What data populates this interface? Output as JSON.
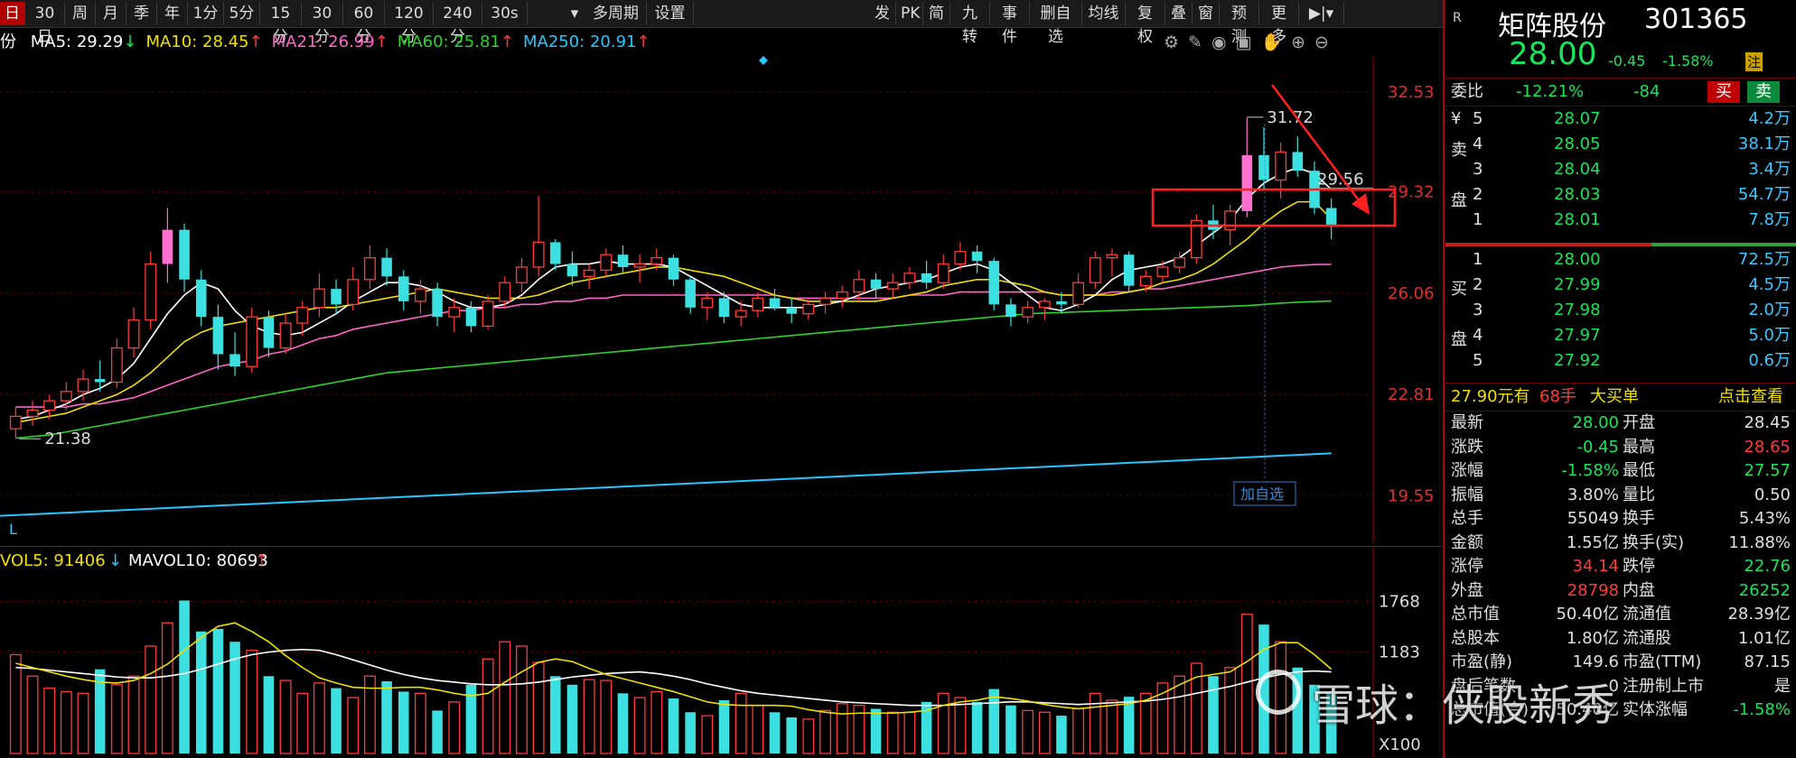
{
  "toolbar": {
    "periods": [
      "日",
      "30日",
      "周",
      "月",
      "季",
      "年",
      "1分",
      "5分",
      "15分",
      "30分",
      "60分",
      "120分",
      "240分",
      "30s"
    ],
    "selected": "日",
    "multi": "多周期",
    "settings": "设置",
    "right_tools": [
      "发",
      "PK",
      "简",
      "九转",
      "事件",
      "删自选",
      "均线",
      "复权",
      "叠",
      "窗",
      "预测",
      "更多"
    ]
  },
  "stock": {
    "badge": "R",
    "name": "矩阵股份",
    "code": "301365",
    "price": "28.00",
    "change": "-0.45",
    "pct": "-1.58%",
    "tag": "注"
  },
  "ma": {
    "prefix": "份",
    "items": [
      {
        "label": "MA5: 29.29",
        "arrow": "↓",
        "color": "#ffffff",
        "arrow_color": "#19e65a"
      },
      {
        "label": "MA10: 28.45",
        "arrow": "↑",
        "color": "#f0e000",
        "arrow_color": "#ff3b3b"
      },
      {
        "label": "MA21: 26.99",
        "arrow": "↑",
        "color": "#ff66cc",
        "arrow_color": "#ff3b3b"
      },
      {
        "label": "MA60: 25.81",
        "arrow": "↑",
        "color": "#2cd42c",
        "arrow_color": "#ff3b3b"
      },
      {
        "label": "MA250: 20.91",
        "arrow": "↑",
        "color": "#27c8ff",
        "arrow_color": "#ff3b3b"
      }
    ]
  },
  "chart_data": {
    "type": "candlestick",
    "ylim": [
      18.6,
      33.4
    ],
    "y_ticks": [
      "32.53",
      "29.32",
      "26.06",
      "22.81",
      "19.55"
    ],
    "y_tick_values": [
      32.53,
      29.32,
      26.06,
      22.81,
      19.55
    ],
    "annotations": {
      "high": "31.72",
      "low": "21.38",
      "current": "29.56",
      "add_watch": "加自选",
      "axis_tag": "L"
    },
    "candles": [
      [
        21.7,
        22.4,
        21.4,
        22.1
      ],
      [
        22.1,
        22.6,
        21.8,
        22.3
      ],
      [
        22.3,
        22.8,
        22.0,
        22.6
      ],
      [
        22.6,
        23.2,
        22.3,
        22.9
      ],
      [
        22.9,
        23.6,
        22.6,
        23.3
      ],
      [
        23.3,
        23.9,
        22.9,
        23.2
      ],
      [
        23.2,
        24.6,
        23.0,
        24.3
      ],
      [
        24.3,
        25.6,
        24.0,
        25.2
      ],
      [
        25.2,
        27.4,
        24.9,
        27.0
      ],
      [
        27.0,
        28.8,
        26.4,
        28.1
      ],
      [
        28.1,
        28.3,
        26.1,
        26.5
      ],
      [
        26.5,
        26.8,
        25.0,
        25.3
      ],
      [
        25.3,
        25.7,
        23.6,
        24.1
      ],
      [
        24.1,
        24.8,
        23.4,
        23.7
      ],
      [
        23.7,
        25.6,
        23.5,
        25.3
      ],
      [
        25.3,
        25.5,
        24.0,
        24.3
      ],
      [
        24.3,
        25.4,
        24.1,
        25.1
      ],
      [
        25.1,
        25.8,
        24.7,
        25.6
      ],
      [
        25.6,
        26.7,
        25.3,
        26.2
      ],
      [
        26.2,
        26.5,
        25.4,
        25.7
      ],
      [
        25.7,
        26.9,
        25.5,
        26.5
      ],
      [
        26.5,
        27.6,
        26.2,
        27.2
      ],
      [
        27.2,
        27.5,
        26.3,
        26.6
      ],
      [
        26.6,
        26.8,
        25.5,
        25.8
      ],
      [
        25.8,
        26.5,
        25.4,
        26.2
      ],
      [
        26.2,
        26.4,
        25.0,
        25.3
      ],
      [
        25.3,
        25.9,
        24.8,
        25.6
      ],
      [
        25.6,
        25.8,
        24.8,
        25.0
      ],
      [
        25.0,
        26.0,
        24.9,
        25.8
      ],
      [
        25.8,
        26.6,
        25.6,
        26.4
      ],
      [
        26.4,
        27.2,
        26.1,
        26.9
      ],
      [
        26.9,
        29.2,
        26.6,
        27.7
      ],
      [
        27.7,
        27.8,
        26.8,
        27.0
      ],
      [
        27.0,
        27.4,
        26.3,
        26.6
      ],
      [
        26.6,
        27.0,
        26.2,
        26.8
      ],
      [
        26.8,
        27.5,
        26.6,
        27.3
      ],
      [
        27.3,
        27.6,
        26.7,
        26.9
      ],
      [
        26.9,
        27.3,
        26.4,
        27.0
      ],
      [
        27.0,
        27.5,
        26.8,
        27.2
      ],
      [
        27.2,
        27.3,
        26.3,
        26.5
      ],
      [
        26.5,
        26.6,
        25.4,
        25.6
      ],
      [
        25.6,
        26.1,
        25.2,
        25.9
      ],
      [
        25.9,
        26.1,
        25.1,
        25.3
      ],
      [
        25.3,
        25.8,
        25.0,
        25.5
      ],
      [
        25.5,
        26.1,
        25.3,
        25.9
      ],
      [
        25.9,
        26.2,
        25.5,
        25.6
      ],
      [
        25.6,
        25.9,
        25.1,
        25.4
      ],
      [
        25.4,
        25.9,
        25.2,
        25.7
      ],
      [
        25.7,
        26.1,
        25.4,
        25.9
      ],
      [
        25.9,
        26.3,
        25.6,
        26.1
      ],
      [
        26.1,
        26.8,
        25.8,
        26.5
      ],
      [
        26.5,
        26.7,
        25.9,
        26.2
      ],
      [
        26.2,
        26.7,
        25.9,
        26.4
      ],
      [
        26.4,
        26.9,
        26.2,
        26.7
      ],
      [
        26.7,
        27.1,
        26.2,
        26.4
      ],
      [
        26.4,
        27.3,
        26.2,
        27.0
      ],
      [
        27.0,
        27.7,
        26.8,
        27.4
      ],
      [
        27.4,
        27.6,
        26.7,
        27.1
      ],
      [
        27.1,
        27.2,
        25.5,
        25.7
      ],
      [
        25.7,
        25.9,
        25.0,
        25.3
      ],
      [
        25.3,
        25.8,
        25.1,
        25.6
      ],
      [
        25.6,
        25.9,
        25.2,
        25.8
      ],
      [
        25.8,
        26.1,
        25.4,
        25.7
      ],
      [
        25.7,
        26.7,
        25.6,
        26.4
      ],
      [
        26.4,
        27.4,
        26.2,
        27.2
      ],
      [
        27.2,
        27.5,
        26.6,
        27.3
      ],
      [
        27.3,
        27.4,
        26.1,
        26.3
      ],
      [
        26.3,
        26.8,
        26.1,
        26.6
      ],
      [
        26.6,
        27.1,
        26.4,
        26.9
      ],
      [
        26.9,
        27.4,
        26.7,
        27.2
      ],
      [
        27.2,
        28.6,
        27.0,
        28.4
      ],
      [
        28.4,
        28.9,
        27.8,
        28.1
      ],
      [
        28.1,
        28.9,
        27.6,
        28.7
      ],
      [
        28.7,
        31.7,
        28.5,
        30.5
      ],
      [
        30.5,
        31.4,
        29.4,
        29.7
      ],
      [
        29.7,
        30.9,
        29.1,
        30.6
      ],
      [
        30.6,
        31.1,
        29.8,
        30.0
      ],
      [
        30.0,
        30.3,
        28.6,
        28.8
      ],
      [
        28.8,
        29.1,
        27.8,
        28.2
      ]
    ],
    "ma5": [
      22.0,
      22.1,
      22.3,
      22.5,
      22.8,
      23.0,
      23.3,
      23.8,
      24.6,
      25.4,
      26.0,
      26.4,
      26.2,
      25.5,
      25.0,
      24.8,
      24.7,
      24.8,
      25.1,
      25.4,
      25.8,
      26.1,
      26.4,
      26.4,
      26.3,
      26.1,
      25.8,
      25.6,
      25.6,
      25.7,
      26.0,
      26.5,
      26.9,
      27.0,
      27.0,
      27.1,
      27.0,
      27.0,
      27.0,
      26.9,
      26.6,
      26.3,
      26.0,
      25.7,
      25.6,
      25.6,
      25.6,
      25.6,
      25.7,
      25.8,
      26.0,
      26.2,
      26.3,
      26.4,
      26.5,
      26.7,
      26.9,
      27.0,
      26.8,
      26.4,
      26.0,
      25.6,
      25.5,
      25.7,
      26.0,
      26.5,
      26.8,
      26.9,
      27.0,
      27.2,
      27.6,
      28.0,
      28.4,
      29.1,
      29.6,
      29.9,
      30.1,
      29.9,
      29.4
    ],
    "ma10": [
      21.9,
      22.0,
      22.1,
      22.2,
      22.4,
      22.6,
      22.8,
      23.1,
      23.5,
      24.0,
      24.5,
      24.8,
      25.0,
      25.1,
      25.2,
      25.3,
      25.4,
      25.5,
      25.6,
      25.6,
      25.7,
      25.8,
      25.9,
      26.0,
      26.1,
      26.2,
      26.1,
      26.0,
      25.9,
      25.9,
      25.9,
      26.0,
      26.2,
      26.4,
      26.5,
      26.6,
      26.7,
      26.8,
      26.9,
      26.9,
      26.8,
      26.7,
      26.6,
      26.4,
      26.2,
      26.0,
      25.9,
      25.8,
      25.8,
      25.8,
      25.8,
      25.8,
      25.9,
      26.0,
      26.1,
      26.3,
      26.4,
      26.5,
      26.5,
      26.4,
      26.3,
      26.1,
      26.0,
      26.0,
      26.0,
      26.0,
      26.1,
      26.2,
      26.4,
      26.5,
      26.7,
      27.0,
      27.4,
      27.8,
      28.3,
      28.7,
      29.0,
      29.0,
      28.45
    ],
    "ma21": [
      22.4,
      22.4,
      22.4,
      22.4,
      22.5,
      22.5,
      22.6,
      22.7,
      22.9,
      23.1,
      23.3,
      23.5,
      23.7,
      23.8,
      23.9,
      24.1,
      24.2,
      24.4,
      24.6,
      24.7,
      24.9,
      25.0,
      25.1,
      25.2,
      25.3,
      25.4,
      25.5,
      25.5,
      25.6,
      25.6,
      25.7,
      25.7,
      25.8,
      25.8,
      25.9,
      25.9,
      26.0,
      26.0,
      26.0,
      26.0,
      26.0,
      26.0,
      26.0,
      26.0,
      26.0,
      26.0,
      25.9,
      25.9,
      25.9,
      25.9,
      25.9,
      25.9,
      25.9,
      26.0,
      26.0,
      26.0,
      26.1,
      26.1,
      26.1,
      26.1,
      26.1,
      26.1,
      26.0,
      26.0,
      26.0,
      26.1,
      26.1,
      26.2,
      26.2,
      26.3,
      26.4,
      26.5,
      26.6,
      26.7,
      26.8,
      26.9,
      26.95,
      26.98,
      26.99
    ],
    "ma60": [
      21.4,
      21.45,
      21.5,
      21.6,
      21.7,
      21.8,
      21.9,
      22.0,
      22.1,
      22.2,
      22.3,
      22.4,
      22.5,
      22.6,
      22.7,
      22.8,
      22.9,
      23.0,
      23.1,
      23.2,
      23.3,
      23.4,
      23.5,
      23.55,
      23.6,
      23.65,
      23.7,
      23.75,
      23.8,
      23.85,
      23.9,
      23.95,
      24.0,
      24.05,
      24.1,
      24.15,
      24.2,
      24.25,
      24.3,
      24.35,
      24.4,
      24.45,
      24.5,
      24.55,
      24.6,
      24.65,
      24.7,
      24.75,
      24.8,
      24.85,
      24.9,
      24.95,
      25.0,
      25.05,
      25.1,
      25.15,
      25.2,
      25.25,
      25.3,
      25.35,
      25.4,
      25.42,
      25.44,
      25.46,
      25.48,
      25.5,
      25.52,
      25.54,
      25.56,
      25.58,
      25.6,
      25.62,
      25.64,
      25.66,
      25.7,
      25.74,
      25.77,
      25.79,
      25.81
    ],
    "ma250_range": [
      18.9,
      20.91
    ],
    "volume": {
      "ylim": [
        0,
        2100
      ],
      "y_ticks": [
        "1768",
        "1183"
      ],
      "y_tick_values": [
        1768,
        1183
      ],
      "unit": "X100",
      "label_vol5": "VOL5: 91406",
      "vol5_arrow": "↓",
      "label_vol10": "MAVOL10: 80693",
      "vol10_arrow": "↑",
      "values": [
        1150,
        900,
        760,
        720,
        700,
        980,
        800,
        900,
        1250,
        1520,
        1780,
        1420,
        1450,
        1300,
        1200,
        900,
        850,
        700,
        820,
        760,
        650,
        900,
        840,
        720,
        700,
        500,
        600,
        800,
        1100,
        1300,
        1250,
        1060,
        900,
        800,
        860,
        850,
        700,
        650,
        720,
        640,
        480,
        440,
        620,
        700,
        560,
        480,
        420,
        400,
        500,
        580,
        560,
        520,
        480,
        480,
        600,
        700,
        650,
        600,
        750,
        560,
        500,
        480,
        440,
        520,
        700,
        620,
        660,
        700,
        820,
        900,
        1050,
        900,
        1000,
        1620,
        1500,
        1300,
        1000,
        800,
        700
      ],
      "vol5": [
        1050,
        1000,
        950,
        900,
        860,
        830,
        820,
        850,
        930,
        1040,
        1200,
        1350,
        1480,
        1520,
        1420,
        1300,
        1140,
        1000,
        880,
        820,
        770,
        760,
        760,
        770,
        770,
        740,
        700,
        670,
        700,
        830,
        950,
        1060,
        1100,
        1070,
        990,
        920,
        870,
        820,
        770,
        720,
        660,
        600,
        570,
        560,
        560,
        560,
        550,
        510,
        480,
        460,
        470,
        470,
        470,
        480,
        500,
        560,
        600,
        620,
        660,
        640,
        610,
        570,
        540,
        520,
        540,
        560,
        580,
        620,
        700,
        800,
        890,
        920,
        950,
        1070,
        1210,
        1290,
        1290,
        1150,
        980
      ],
      "vol10": [
        1000,
        990,
        970,
        950,
        930,
        910,
        890,
        880,
        880,
        900,
        930,
        980,
        1040,
        1100,
        1150,
        1180,
        1200,
        1210,
        1200,
        1150,
        1090,
        1030,
        970,
        920,
        880,
        850,
        830,
        810,
        800,
        800,
        810,
        830,
        860,
        890,
        910,
        930,
        940,
        950,
        930,
        900,
        860,
        810,
        770,
        730,
        700,
        680,
        660,
        640,
        620,
        600,
        590,
        580,
        570,
        560,
        560,
        560,
        570,
        580,
        590,
        600,
        600,
        590,
        580,
        570,
        580,
        590,
        600,
        610,
        630,
        660,
        700,
        740,
        780,
        830,
        880,
        920,
        950,
        960,
        950
      ]
    }
  },
  "orderbook": {
    "weibi_label": "委比",
    "weibi_pct": "-12.21%",
    "weibi_diff": "-84",
    "buy_btn": "买",
    "sell_btn": "卖",
    "sell_side_label": [
      "卖",
      "盘"
    ],
    "buy_side_label": [
      "买",
      "盘"
    ],
    "sells": [
      {
        "lvl": "5",
        "price": "28.07",
        "vol": "4.2万",
        "mark": "¥"
      },
      {
        "lvl": "4",
        "price": "28.05",
        "vol": "38.1万",
        "mark": ""
      },
      {
        "lvl": "3",
        "price": "28.04",
        "vol": "3.4万",
        "mark": ""
      },
      {
        "lvl": "2",
        "price": "28.03",
        "vol": "54.7万",
        "mark": ""
      },
      {
        "lvl": "1",
        "price": "28.01",
        "vol": "7.8万",
        "mark": ""
      }
    ],
    "buys": [
      {
        "lvl": "1",
        "price": "28.00",
        "vol": "72.5万"
      },
      {
        "lvl": "2",
        "price": "27.99",
        "vol": "4.5万"
      },
      {
        "lvl": "3",
        "price": "27.98",
        "vol": "2.0万"
      },
      {
        "lvl": "4",
        "price": "27.97",
        "vol": "5.0万"
      },
      {
        "lvl": "5",
        "price": "27.92",
        "vol": "0.6万"
      }
    ],
    "bigorder": {
      "price_text": "27.90元有",
      "hands": "68手",
      "label": "大买单",
      "link": "点击查看"
    }
  },
  "quotes": [
    {
      "l": "最新",
      "v": "28.00",
      "vc": "g",
      "l2": "开盘",
      "v2": "28.45",
      "v2c": "w"
    },
    {
      "l": "涨跌",
      "v": "-0.45",
      "vc": "g",
      "l2": "最高",
      "v2": "28.65",
      "v2c": "r"
    },
    {
      "l": "涨幅",
      "v": "-1.58%",
      "vc": "g",
      "l2": "最低",
      "v2": "27.57",
      "v2c": "g"
    },
    {
      "l": "振幅",
      "v": "3.80%",
      "vc": "w",
      "l2": "量比",
      "v2": "0.50",
      "v2c": "w"
    },
    {
      "l": "总手",
      "v": "55049",
      "vc": "w",
      "l2": "换手",
      "v2": "5.43%",
      "v2c": "w"
    },
    {
      "l": "金额",
      "v": "1.55亿",
      "vc": "w",
      "l2": "换手(实)",
      "v2": "11.88%",
      "v2c": "w"
    },
    {
      "l": "涨停",
      "v": "34.14",
      "vc": "r",
      "l2": "跌停",
      "v2": "22.76",
      "v2c": "g"
    },
    {
      "l": "外盘",
      "v": "28798",
      "vc": "r",
      "l2": "内盘",
      "v2": "26252",
      "v2c": "g"
    },
    {
      "l": "总市值",
      "v": "50.40亿",
      "vc": "w",
      "l2": "流通值",
      "v2": "28.39亿",
      "v2c": "w"
    },
    {
      "l": "总股本",
      "v": "1.80亿",
      "vc": "w",
      "l2": "流通股",
      "v2": "1.01亿",
      "v2c": "w"
    },
    {
      "l": "市盈(静)",
      "v": "149.6",
      "vc": "w",
      "l2": "市盈(TTM)",
      "v2": "87.15",
      "v2c": "w"
    },
    {
      "l": "盘后笔数",
      "v": "0",
      "vc": "w",
      "l2": "注册制上市",
      "v2": "是",
      "v2c": "w"
    },
    {
      "l": "总市值(合)",
      "v": "50.40亿",
      "vc": "w",
      "l2": "实体涨幅",
      "v2": "-1.58%",
      "v2c": "g"
    }
  ],
  "watermark": "雪球：侠股新秀"
}
